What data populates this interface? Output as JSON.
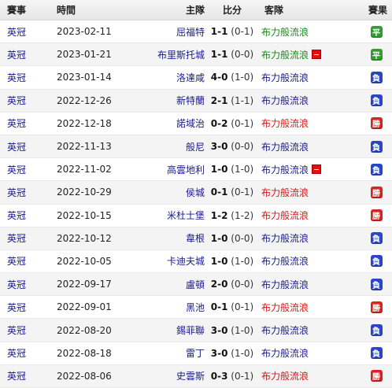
{
  "header": {
    "competition": "賽事",
    "time": "時間",
    "home": "主隊",
    "score": "比分",
    "away": "客隊",
    "result": "賽果"
  },
  "colors": {
    "draw": "#2f9e2f",
    "loss": "#2a45c8",
    "win": "#d8231e"
  },
  "rows": [
    {
      "comp": "英冠",
      "date": "2023-02-11",
      "home": "屈福特",
      "score": "1-1",
      "half": "(0-1)",
      "away": "布力般流浪",
      "away_color": "green",
      "card": false,
      "result": "平",
      "type": "draw"
    },
    {
      "comp": "英冠",
      "date": "2023-01-21",
      "home": "布里斯托城",
      "score": "1-1",
      "half": "(0-0)",
      "away": "布力般流浪",
      "away_color": "green",
      "card": true,
      "result": "平",
      "type": "draw"
    },
    {
      "comp": "英冠",
      "date": "2023-01-14",
      "home": "洛達咸",
      "score": "4-0",
      "half": "(1-0)",
      "away": "布力般流浪",
      "away_color": "blue",
      "card": false,
      "result": "負",
      "type": "loss"
    },
    {
      "comp": "英冠",
      "date": "2022-12-26",
      "home": "新特蘭",
      "score": "2-1",
      "half": "(1-1)",
      "away": "布力般流浪",
      "away_color": "blue",
      "card": false,
      "result": "負",
      "type": "loss"
    },
    {
      "comp": "英冠",
      "date": "2022-12-18",
      "home": "諾域治",
      "score": "0-2",
      "half": "(0-1)",
      "away": "布力般流浪",
      "away_color": "red",
      "card": false,
      "result": "勝",
      "type": "win"
    },
    {
      "comp": "英冠",
      "date": "2022-11-13",
      "home": "般尼",
      "score": "3-0",
      "half": "(0-0)",
      "away": "布力般流浪",
      "away_color": "blue",
      "card": false,
      "result": "負",
      "type": "loss"
    },
    {
      "comp": "英冠",
      "date": "2022-11-02",
      "home": "高雲地利",
      "score": "1-0",
      "half": "(1-0)",
      "away": "布力般流浪",
      "away_color": "blue",
      "card": true,
      "result": "負",
      "type": "loss"
    },
    {
      "comp": "英冠",
      "date": "2022-10-29",
      "home": "侯城",
      "score": "0-1",
      "half": "(0-1)",
      "away": "布力般流浪",
      "away_color": "red",
      "card": false,
      "result": "勝",
      "type": "win"
    },
    {
      "comp": "英冠",
      "date": "2022-10-15",
      "home": "米杜士堡",
      "score": "1-2",
      "half": "(1-2)",
      "away": "布力般流浪",
      "away_color": "red",
      "card": false,
      "result": "勝",
      "type": "win"
    },
    {
      "comp": "英冠",
      "date": "2022-10-12",
      "home": "韋根",
      "score": "1-0",
      "half": "(0-0)",
      "away": "布力般流浪",
      "away_color": "blue",
      "card": false,
      "result": "負",
      "type": "loss"
    },
    {
      "comp": "英冠",
      "date": "2022-10-05",
      "home": "卡迪夫城",
      "score": "1-0",
      "half": "(1-0)",
      "away": "布力般流浪",
      "away_color": "blue",
      "card": false,
      "result": "負",
      "type": "loss"
    },
    {
      "comp": "英冠",
      "date": "2022-09-17",
      "home": "盧頓",
      "score": "2-0",
      "half": "(0-0)",
      "away": "布力般流浪",
      "away_color": "blue",
      "card": false,
      "result": "負",
      "type": "loss"
    },
    {
      "comp": "英冠",
      "date": "2022-09-01",
      "home": "黑池",
      "score": "0-1",
      "half": "(0-1)",
      "away": "布力般流浪",
      "away_color": "red",
      "card": false,
      "result": "勝",
      "type": "win"
    },
    {
      "comp": "英冠",
      "date": "2022-08-20",
      "home": "錫菲聯",
      "score": "3-0",
      "half": "(1-0)",
      "away": "布力般流浪",
      "away_color": "blue",
      "card": false,
      "result": "負",
      "type": "loss"
    },
    {
      "comp": "英冠",
      "date": "2022-08-18",
      "home": "雷丁",
      "score": "3-0",
      "half": "(1-0)",
      "away": "布力般流浪",
      "away_color": "blue",
      "card": false,
      "result": "負",
      "type": "loss"
    },
    {
      "comp": "英冠",
      "date": "2022-08-06",
      "home": "史雲斯",
      "score": "0-3",
      "half": "(0-1)",
      "away": "布力般流浪",
      "away_color": "red",
      "card": false,
      "result": "勝",
      "type": "win"
    }
  ]
}
